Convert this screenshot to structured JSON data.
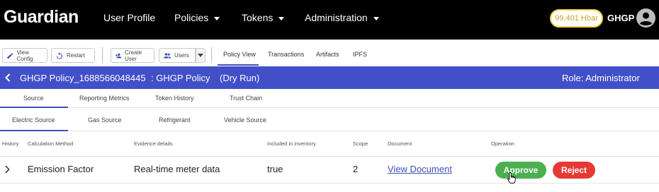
{
  "topbar": {
    "logo": "Guardian",
    "nav": [
      "User Profile",
      "Policies",
      "Tokens",
      "Administration"
    ],
    "balance": "99.401 Hbar",
    "username": "GHGP"
  },
  "toolbar": {
    "view_config": "View Config",
    "restart": "Restart",
    "create_user": "Create User",
    "users": "Users",
    "tabs": [
      "Policy View",
      "Transactions",
      "Artifacts",
      "IPFS"
    ]
  },
  "policy": {
    "name": "GHGP Policy_1688566048445",
    "sub": ": GHGP Policy",
    "mode": "(Dry Run)",
    "role": "Role: Administrator"
  },
  "tabs_primary": [
    "Source",
    "Reporting Metrics",
    "Token History",
    "Trust Chain"
  ],
  "tabs_secondary": [
    "Electric Source",
    "Gas Source",
    "Refrigerant",
    "Vehicle Source"
  ],
  "table": {
    "columns": [
      "History",
      "Calculation Method",
      "Evidence details",
      "Included in inventory",
      "Scope",
      "Document",
      "Operation"
    ],
    "rows": [
      {
        "calculation_method": "Emission Factor",
        "evidence_details": "Real-time meter data",
        "included": "true",
        "scope": "2",
        "document": "View Document",
        "approve": "Approve",
        "reject": "Reject"
      }
    ]
  },
  "colors": {
    "accent": "#4150c8",
    "approve": "#4caf50",
    "reject": "#e53935",
    "balance_border": "#f5d24a"
  }
}
